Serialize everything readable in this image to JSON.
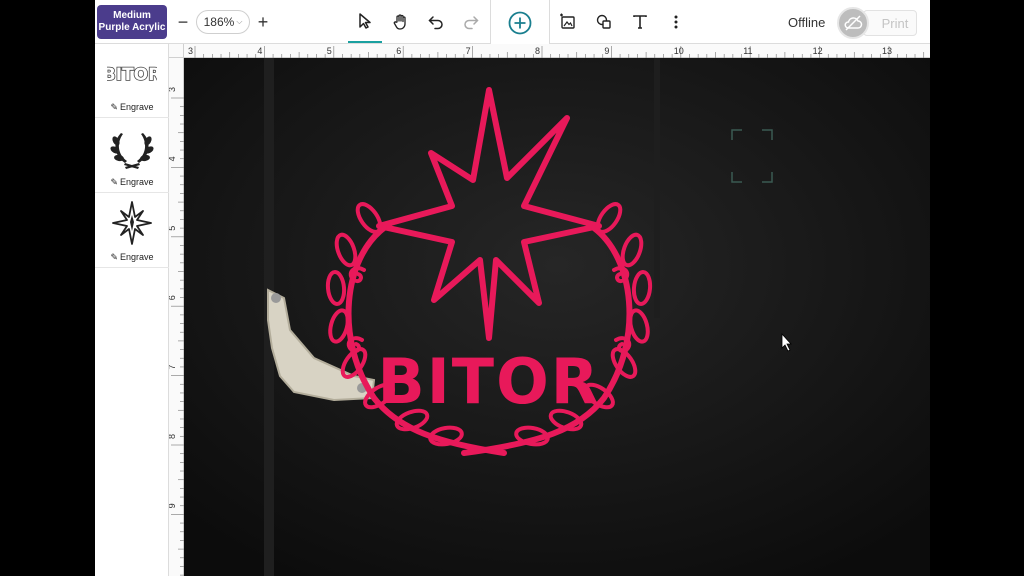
{
  "toolbar": {
    "material_line1": "Medium",
    "material_line2": "Purple Acrylic",
    "zoom_out": "−",
    "zoom_value": "186%",
    "zoom_in": "+",
    "offline": "Offline",
    "print": "Print",
    "icons": [
      "select-arrow-icon",
      "hand-pan-icon",
      "undo-icon",
      "redo-icon",
      "add-circle-icon",
      "image-trace-icon",
      "shapes-icon",
      "text-icon",
      "more-vertical-icon",
      "cloud-off-icon"
    ]
  },
  "layers": [
    {
      "name": "BITOR text",
      "operation": "Engrave"
    },
    {
      "name": "laurel wreath",
      "operation": "Engrave"
    },
    {
      "name": "star",
      "operation": "Engrave"
    }
  ],
  "rulers": {
    "top": [
      "3",
      "4",
      "5",
      "6",
      "7",
      "8",
      "9",
      "10",
      "11",
      "12",
      "13"
    ],
    "left": [
      "3",
      "4",
      "5",
      "6",
      "7",
      "8",
      "9"
    ]
  },
  "design": {
    "text": "BITOR",
    "color": "#e8195a"
  },
  "colors": {
    "accent": "#1aa0a0",
    "material_badge": "#4b3c8c",
    "design": "#e8195a"
  }
}
